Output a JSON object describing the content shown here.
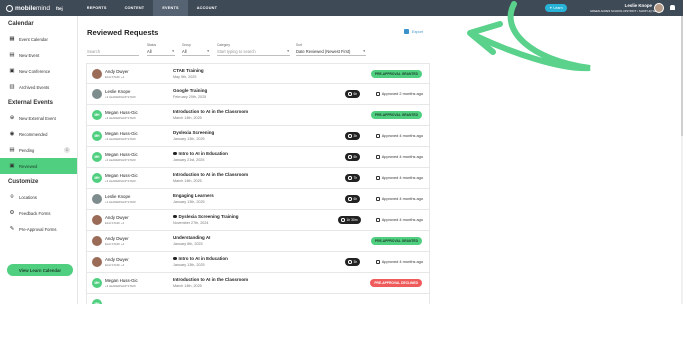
{
  "app": {
    "logo_bold": "mobile",
    "logo_light": "mind",
    "logo_sub": "ftej",
    "nav_tabs": [
      "REPORTS",
      "CONTENT",
      "EVENTS",
      "ACCOUNT"
    ],
    "learn_label": "Learn",
    "user_name": "Leslie Knope",
    "user_school": "GREEN ACRES SCHOOL DISTRICT • SHOP HQ SELECT"
  },
  "sidebar": {
    "calendar_heading": "Calendar",
    "calendar_items": [
      "Event Calendar",
      "New Event",
      "New Conference",
      "Archived Events"
    ],
    "external_heading": "External Events",
    "external_items": [
      "New External Event",
      "Recommended",
      "Pending",
      "Reviewed"
    ],
    "pending_badge": "1",
    "customize_heading": "Customize",
    "customize_items": [
      "Locations",
      "Feedback Forms",
      "Pre-Approval Forms"
    ],
    "learn_calendar_button": "View Learn Calendar"
  },
  "main": {
    "title": "Reviewed Requests",
    "export_label": "Export",
    "filters": {
      "search_placeholder": "Search",
      "status_label": "Status",
      "status_value": "All",
      "group_label": "Group",
      "group_value": "All",
      "category_label": "Category",
      "category_placeholder": "Start typing to search",
      "sort_label": "Sort",
      "sort_value": "Date Reviewed (Newest First)"
    },
    "rows": [
      {
        "name": "Andy Dwyer",
        "role": "EAH STAFF +4",
        "plus": "",
        "course": "CTAE Training",
        "date": "May 9th, 2025",
        "status": "PRE-APPROVAL GRANTED",
        "kind": "granted",
        "time": "",
        "approved": "",
        "avatar": "photo1",
        "initials": "",
        "dot": false
      },
      {
        "name": "Leslie Knope",
        "role": "+3 LEADERSHIP STAFF",
        "plus": "+3",
        "course": "Google Training",
        "date": "February 20th, 2025",
        "status": "",
        "kind": "approved",
        "time": "6h",
        "approved": "Approved 2 months ago",
        "avatar": "photo2",
        "initials": "",
        "dot": false
      },
      {
        "name": "Megan Huss-Gic",
        "role": "+3 LEADERSHIP STAFF",
        "plus": "+3",
        "course": "Introduction to AI in the Classroom",
        "date": "March 14th, 2025",
        "status": "PRE-APPROVAL GRANTED",
        "kind": "granted",
        "time": "",
        "approved": "",
        "avatar": "mh",
        "initials": "MH",
        "dot": false
      },
      {
        "name": "Megan Huss-Gic",
        "role": "+3 LEADERSHIP STAFF",
        "plus": "+3",
        "course": "Dyslexia Screening",
        "date": "January 13th, 2025",
        "status": "",
        "kind": "approved",
        "time": "3h",
        "approved": "Approved 4 months ago",
        "avatar": "mh",
        "initials": "MH",
        "dot": false
      },
      {
        "name": "Megan Huss-Gic",
        "role": "+3 LEADERSHIP STAFF",
        "plus": "+3",
        "course": "Intro to AI in Education",
        "date": "January 21st, 2025",
        "status": "",
        "kind": "approved",
        "time": "6h",
        "approved": "Approved 4 months ago",
        "avatar": "mh",
        "initials": "MH",
        "dot": true
      },
      {
        "name": "Megan Huss-Gic",
        "role": "+3 LEADERSHIP STAFF",
        "plus": "+3",
        "course": "Introduction to AI in the Classroom",
        "date": "March 14th, 2025",
        "status": "",
        "kind": "approved",
        "time": "7h",
        "approved": "Approved 4 months ago",
        "avatar": "mh",
        "initials": "MH",
        "dot": false
      },
      {
        "name": "Leslie Knope",
        "role": "+3 LEADERSHIP STAFF",
        "plus": "+3",
        "course": "Engaging Learners",
        "date": "January 13th, 2025",
        "status": "",
        "kind": "approved",
        "time": "6h",
        "approved": "Approved 4 months ago",
        "avatar": "photo2",
        "initials": "",
        "dot": false
      },
      {
        "name": "Andy Dwyer",
        "role": "EAH STAFF +4",
        "plus": "",
        "course": "Dyslexia Screening Training",
        "date": "November 27th, 2024",
        "status": "",
        "kind": "approved",
        "time": "1h 30m",
        "approved": "Approved 4 months ago",
        "avatar": "photo1",
        "initials": "",
        "dot": true
      },
      {
        "name": "Andy Dwyer",
        "role": "EAH STAFF +4",
        "plus": "",
        "course": "Understanding AI",
        "date": "January 6th, 2025",
        "status": "PRE-APPROVAL GRANTED",
        "kind": "granted",
        "time": "",
        "approved": "",
        "avatar": "photo1",
        "initials": "",
        "dot": false
      },
      {
        "name": "Andy Dwyer",
        "role": "EAH STAFF +4",
        "plus": "",
        "course": "Intro to AI in Education",
        "date": "January 13th, 2025",
        "status": "",
        "kind": "approved",
        "time": "3h",
        "approved": "Approved 4 months ago",
        "avatar": "photo1",
        "initials": "",
        "dot": true
      },
      {
        "name": "Megan Huss-Gic",
        "role": "+3 LEADERSHIP STAFF",
        "plus": "+3",
        "course": "Introduction to AI in the Classroom",
        "date": "March 14th, 2025",
        "status": "PRE-APPROVAL DECLINED",
        "kind": "declined",
        "time": "",
        "approved": "",
        "avatar": "mh",
        "initials": "MH",
        "dot": false
      },
      {
        "name": "",
        "role": "",
        "plus": "",
        "course": "",
        "date": "",
        "status": "",
        "kind": "empty",
        "time": "",
        "approved": "",
        "avatar": "mh",
        "initials": "MH",
        "dot": false
      }
    ]
  },
  "colors": {
    "topbar": "#3f4a57",
    "accent_green": "#4fcf7f",
    "declined_red": "#ef5b5b",
    "link_blue": "#3b91c9",
    "annotation_arrow": "#5ad28b"
  }
}
